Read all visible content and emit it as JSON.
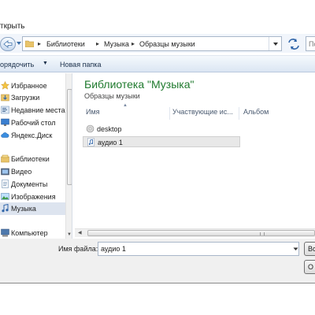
{
  "window": {
    "title": "ткрыть"
  },
  "address": {
    "breadcrumbs": [
      "Библиотеки",
      "Музыка",
      "Образцы музыки"
    ],
    "search_placeholder": "Пс"
  },
  "toolbar": {
    "organize_label": "орядочить",
    "new_folder_label": "Новая папка"
  },
  "nav": {
    "items": [
      {
        "label": "Избранное",
        "icon": "star-icon",
        "selected": false
      },
      {
        "label": "Загрузки",
        "icon": "downloads-folder-icon",
        "selected": false
      },
      {
        "label": "Недавние места",
        "icon": "recent-places-icon",
        "selected": false
      },
      {
        "label": "Рабочий стол",
        "icon": "desktop-icon",
        "selected": false
      },
      {
        "label": "Яндекс.Диск",
        "icon": "cloud-icon",
        "selected": false
      },
      {
        "label": "Библиотеки",
        "icon": "libraries-icon",
        "selected": false
      },
      {
        "label": "Видео",
        "icon": "video-library-icon",
        "selected": false
      },
      {
        "label": "Документы",
        "icon": "documents-library-icon",
        "selected": false
      },
      {
        "label": "Изображения",
        "icon": "pictures-library-icon",
        "selected": false
      },
      {
        "label": "Музыка",
        "icon": "music-library-icon",
        "selected": true
      },
      {
        "label": "Компьютер",
        "icon": "computer-icon",
        "selected": false
      }
    ]
  },
  "main": {
    "library_title": "Библиотека \"Музыка\"",
    "library_subtitle": "Образцы музыки",
    "columns": [
      "Имя",
      "Участвующие ис...",
      "Альбом"
    ],
    "files": [
      {
        "name": "desktop",
        "icon": "settings-file-icon",
        "selected": false
      },
      {
        "name": "аудио 1",
        "icon": "audio-file-icon",
        "selected": true
      }
    ]
  },
  "footer": {
    "filename_label": "Имя файла:",
    "filename_value": "аудио 1",
    "filter_button_label": "Вс",
    "cancel_button_label": "О"
  }
}
